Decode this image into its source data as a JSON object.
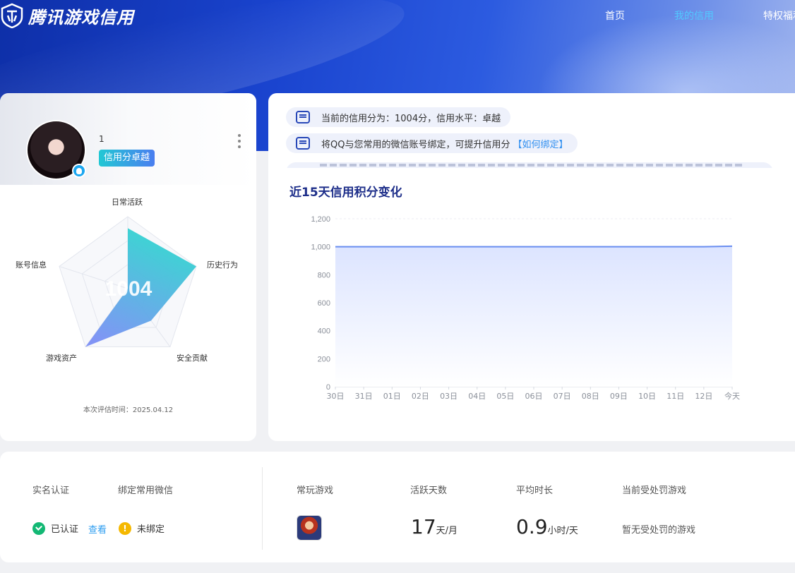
{
  "header": {
    "brand": "腾讯游戏信用",
    "nav": [
      "首页",
      "我的信用",
      "特权福利"
    ],
    "active_nav": "我的信用"
  },
  "profile": {
    "username": "1",
    "credit_tag": "信用分卓越",
    "score": "1004",
    "radar_labels": [
      "日常活跃",
      "历史行为",
      "安全贡献",
      "游戏资产",
      "账号信息"
    ],
    "radar_values": [
      0.84,
      1.0,
      0.55,
      1.0,
      0.0
    ],
    "eval_time": "本次评估时间：2025.04.12"
  },
  "notices": [
    {
      "text": "当前的信用分为：1004分，信用水平：卓越"
    },
    {
      "text": "将QQ与您常用的微信账号绑定，可提升信用分",
      "link": "【如何绑定】"
    }
  ],
  "chart_title": "近15天信用积分变化",
  "chart_data": {
    "type": "area",
    "categories": [
      "30日",
      "31日",
      "01日",
      "02日",
      "03日",
      "04日",
      "05日",
      "06日",
      "07日",
      "08日",
      "09日",
      "10日",
      "11日",
      "12日",
      "今天"
    ],
    "values": [
      1000,
      1000,
      1000,
      1000,
      1000,
      1000,
      1000,
      1000,
      1000,
      1000,
      1000,
      1000,
      1000,
      1000,
      1004
    ],
    "yticks": [
      "0",
      "200",
      "400",
      "600",
      "800",
      "1,000",
      "1,200"
    ],
    "ylim": [
      0,
      1200
    ],
    "line_color": "#6a8ef0",
    "fill_color": "#dfe6ff"
  },
  "bottom": {
    "real_name_label": "实名认证",
    "wechat_label": "绑定常用微信",
    "real_name_status": "已认证",
    "view_link": "查看",
    "wechat_status": "未绑定",
    "fav_game_label": "常玩游戏",
    "active_days_label": "活跃天数",
    "active_days_value": "17",
    "active_days_unit": "天/月",
    "avg_time_label": "平均时长",
    "avg_time_value": "0.9",
    "avg_time_unit": "小时/天",
    "punish_label": "当前受处罚游戏",
    "punish_value": "暂无受处罚的游戏"
  },
  "colors": {
    "brand_blue": "#1a44cf",
    "accent_cyan": "#22c8d4",
    "ok_green": "#13b874",
    "warn_yellow": "#f5b800",
    "link_blue": "#2f8ff0"
  }
}
